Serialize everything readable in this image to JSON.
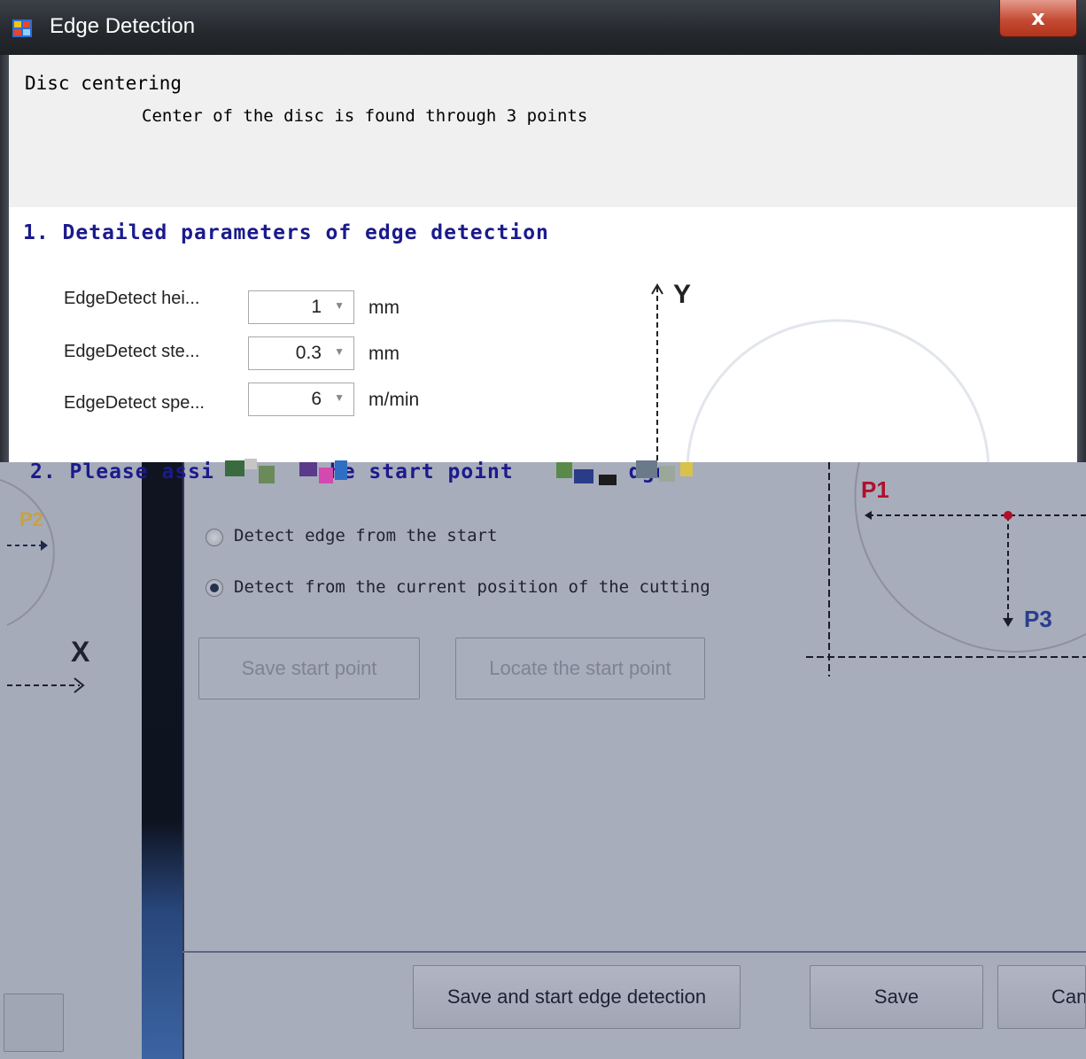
{
  "window": {
    "title": "Edge Detection",
    "close_symbol": "x"
  },
  "header": {
    "title": "Disc centering",
    "subtitle": "Center of the disc is found through 3 points"
  },
  "section1": {
    "title": "1. Detailed parameters of edge detection",
    "params": [
      {
        "label": "EdgeDetect hei...",
        "value": "1",
        "unit": "mm"
      },
      {
        "label": "EdgeDetect ste...",
        "value": "0.3",
        "unit": "mm"
      },
      {
        "label": "EdgeDetect spe...",
        "value": "6",
        "unit": "m/min"
      }
    ]
  },
  "section2": {
    "title_prefix": "2. Please assi",
    "title_mid": "he start point",
    "title_suffix": "dge",
    "options": [
      {
        "label": "Detect edge from the start",
        "checked": false
      },
      {
        "label": "Detect from the current position of the cutting",
        "checked": true
      }
    ],
    "save_start_label": "Save start point",
    "locate_start_label": "Locate the start point"
  },
  "diagram": {
    "y_axis": "Y",
    "x_axis": "X",
    "p1": "P1",
    "p2": "P2",
    "p3": "P3"
  },
  "footer": {
    "save_start_detect_label": "Save and start edge detection",
    "save_label": "Save",
    "cancel_label": "Can"
  },
  "colors": {
    "heading": "#1b1a8c",
    "p1": "#b0102a",
    "p2": "#c8a23c",
    "p3": "#2a3d8f",
    "dim_panel": "#a6abb9"
  },
  "icons": {
    "window_icon": "app-window-icon",
    "dropdown": "chevron-down-icon"
  }
}
